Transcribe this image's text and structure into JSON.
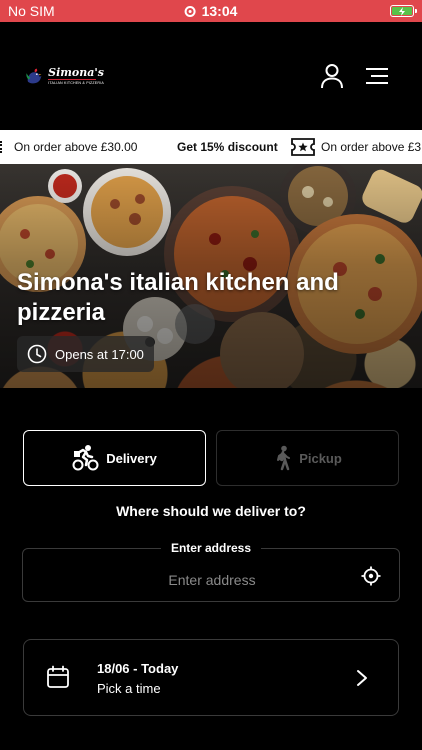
{
  "status_bar": {
    "carrier": "No SIM",
    "time": "13:04",
    "battery_color": "#59c24a"
  },
  "header": {
    "logo_name": "Simona's",
    "logo_tagline": "ITALIAN KITCHEN & PIZZERIA",
    "icons": [
      "user-icon",
      "menu-icon"
    ]
  },
  "promo": {
    "items": [
      {
        "text": "On order above £30.00",
        "bold": false
      },
      {
        "text": "Get 15% discount",
        "bold": true
      },
      {
        "text": "On order above £3",
        "bold": false
      }
    ],
    "icon": "ticket-star-icon"
  },
  "hero": {
    "title": "Simona's italian kitchen and pizzeria",
    "opens_label": "Opens at 17:00"
  },
  "order_mode": {
    "delivery_label": "Delivery",
    "pickup_label": "Pickup",
    "selected": "Delivery"
  },
  "delivery": {
    "question": "Where should we deliver to?",
    "address_label": "Enter address",
    "address_placeholder": "Enter address",
    "address_value": ""
  },
  "time": {
    "date_label": "18/06 - Today",
    "pick_label": "Pick a time"
  },
  "colors": {
    "status_bar": "#e0474c",
    "background": "#000000",
    "promo_background": "#ffffff",
    "disabled": "#5a5a5a"
  }
}
